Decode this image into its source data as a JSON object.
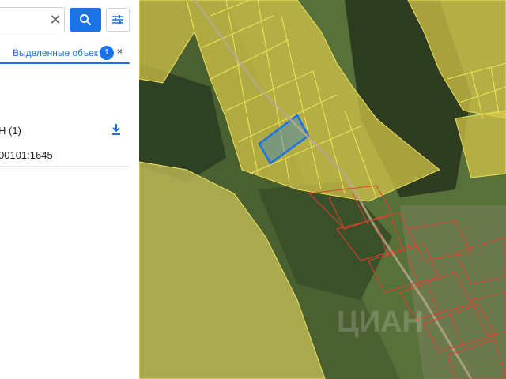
{
  "search": {
    "clear_icon": "close-icon",
    "search_icon": "search-icon",
    "filter_icon": "tune-icon"
  },
  "tab": {
    "label": "Выделенные объекты",
    "count": "1",
    "close": "×",
    "accent": "#1a73e8"
  },
  "results": {
    "group_title": "Н (1)",
    "download_icon": "download-icon",
    "items": [
      "00101:1645"
    ]
  },
  "map": {
    "base": "satellite",
    "overlay_colors": {
      "parcels_fill": "#d7c84a",
      "parcels_stroke": "#f1e35a",
      "buildings_stroke": "#e0402f",
      "selected_stroke": "#1a73e8"
    },
    "watermark": "ЦИАН"
  }
}
